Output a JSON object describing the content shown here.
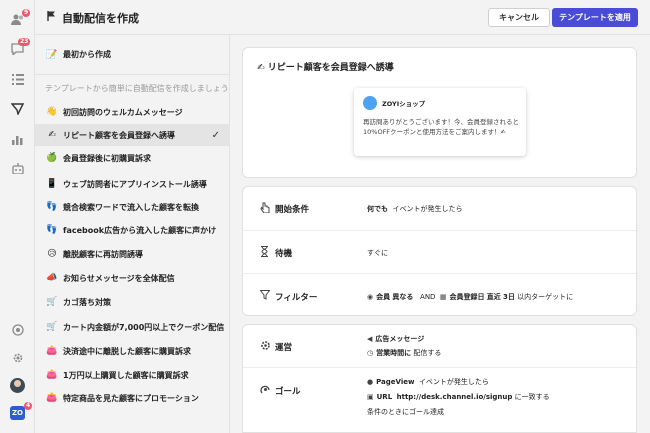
{
  "rail": {
    "items": [
      {
        "icon": "users-icon",
        "badge": "9"
      },
      {
        "icon": "chat-icon",
        "badge": "23"
      },
      {
        "icon": "list-icon",
        "badge": ""
      },
      {
        "icon": "send-icon",
        "badge": ""
      },
      {
        "icon": "stats-icon",
        "badge": ""
      },
      {
        "icon": "bot-icon",
        "badge": ""
      },
      {
        "icon": "status-icon",
        "badge": ""
      },
      {
        "icon": "gear-icon",
        "badge": ""
      }
    ],
    "workspace_label": "ZO",
    "workspace_badge": "4"
  },
  "header": {
    "title": "自動配信を作成",
    "cancel_label": "キャンセル",
    "apply_label": "テンプレートを適用"
  },
  "templates": {
    "scratch_label": "最初から作成",
    "scratch_emoji": "📝",
    "hint": "テンプレートから簡単に自動配信を作成しましょう",
    "items": [
      {
        "emoji": "👋",
        "label": "初回訪問のウェルカムメッセージ",
        "selected": false
      },
      {
        "emoji": "✍",
        "label": "リピート顧客を会員登録へ誘導",
        "selected": true
      },
      {
        "emoji": "🍏",
        "label": "会員登録後に初購買訴求",
        "selected": false
      },
      {
        "emoji": "📱",
        "label": "ウェブ訪問者にアプリインストール誘導",
        "selected": false
      },
      {
        "emoji": "👣",
        "label": "競合検索ワードで流入した顧客を転換",
        "selected": false
      },
      {
        "emoji": "👣",
        "label": "facebook広告から流入した顧客に声かけ",
        "selected": false
      },
      {
        "emoji": "😥",
        "label": "離脱顧客に再訪問誘導",
        "selected": false
      },
      {
        "emoji": "📣",
        "label": "お知らせメッセージを全体配信",
        "selected": false
      },
      {
        "emoji": "🛒",
        "label": "カゴ落ち対策",
        "selected": false
      },
      {
        "emoji": "🛒",
        "label": "カート内金額が7,000円以上でクーポン配信",
        "selected": false
      },
      {
        "emoji": "👛",
        "label": "決済途中に離脱した顧客に購買訴求",
        "selected": false
      },
      {
        "emoji": "👛",
        "label": "1万円以上購買した顧客に購買訴求",
        "selected": false
      },
      {
        "emoji": "👛",
        "label": "特定商品を見た顧客にプロモーション",
        "selected": false
      }
    ]
  },
  "preview": {
    "title_emoji": "✍",
    "title": "リピート顧客を会員登録へ誘導",
    "shop_name": "ZOYIショップ",
    "message": "再訪問ありがとうございます！今、会員登録されると10%OFFクーポンと使用方法をご案内します！✍"
  },
  "conditions": {
    "trigger": {
      "label": "開始条件",
      "value_bold": "何でも",
      "value_rest": "イベントが発生したら"
    },
    "wait": {
      "label": "待機",
      "value": "すぐに"
    },
    "filter": {
      "label": "フィルター",
      "member_label": "会員",
      "member_op": "異なる",
      "and": "AND",
      "date_label": "会員登録日",
      "date_op": "直近",
      "days": "3日",
      "rest": "以内ターゲットに"
    }
  },
  "operation": {
    "label": "運営",
    "line1": "広告メッセージ",
    "line2_bold": "営業時間に",
    "line2_rest": "配信する"
  },
  "goal": {
    "label": "ゴール",
    "line1_bold": "PageView",
    "line1_rest": "イベントが発生したら",
    "line2_bold": "URL",
    "line2_url": "http://desk.channel.io/signup",
    "line2_rest": "に一致する",
    "line3": "条件のときにゴール達成"
  },
  "colors": {
    "accent": "#4a4bd6",
    "badge": "#f0566b",
    "avatar": "#4da3f2"
  }
}
